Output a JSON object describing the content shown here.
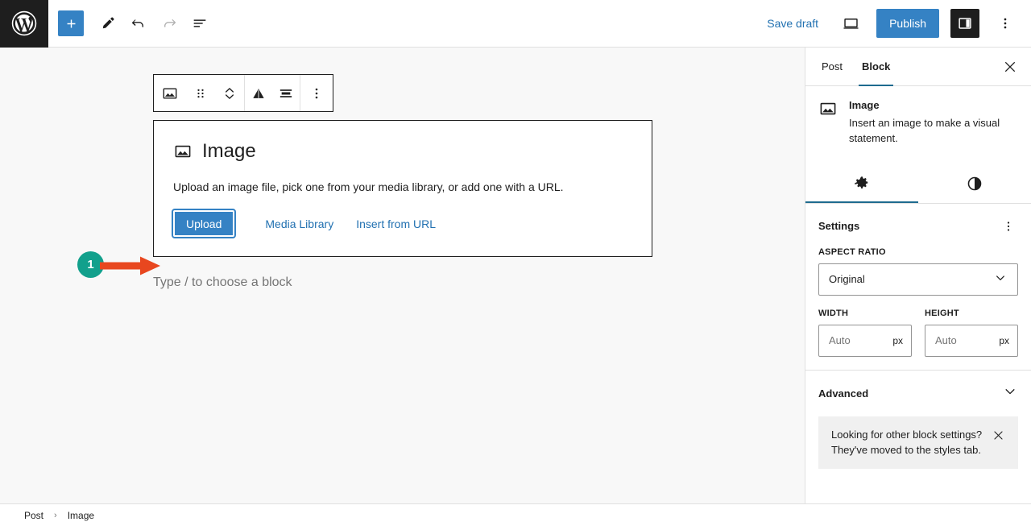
{
  "topbar": {
    "logo_icon": "wordpress-logo-icon",
    "add_block_icon": "plus-icon",
    "tools_icon": "pencil-icon",
    "undo_icon": "undo-arrow-icon",
    "redo_icon": "redo-arrow-icon",
    "list_view_icon": "document-overview-icon",
    "save_draft_label": "Save draft",
    "preview_icon": "desktop-preview-icon",
    "publish_label": "Publish",
    "sidebar_toggle_icon": "settings-panel-icon",
    "options_icon": "three-dots-vertical-icon"
  },
  "block_toolbar": {
    "block_type_icon": "image-block-icon",
    "drag_handle_icon": "drag-handle-dots-icon",
    "move_updown_icon": "move-up-down-chevrons-icon",
    "align_icon": "change-alignment-triangle-icon",
    "width_icon": "full-width-align-icon",
    "options_icon": "three-dots-vertical-icon"
  },
  "image_block": {
    "icon": "image-block-icon",
    "title": "Image",
    "description": "Upload an image file, pick one from your media library, or add one with a URL.",
    "upload_label": "Upload",
    "media_library_label": "Media Library",
    "insert_url_label": "Insert from URL"
  },
  "canvas": {
    "type_prompt": "Type / to choose a block"
  },
  "annotation": {
    "step_number": "1",
    "circle_color": "#12a08c",
    "arrow_color": "#e8471f",
    "arrow_icon": "right-arrow-annotation-icon"
  },
  "sidebar": {
    "tabs": [
      {
        "label": "Post",
        "active": false
      },
      {
        "label": "Block",
        "active": true
      }
    ],
    "close_icon": "close-x-icon",
    "block_card": {
      "icon": "image-block-icon",
      "title": "Image",
      "description": "Insert an image to make a visual statement."
    },
    "subtabs": [
      {
        "icon": "gear-settings-icon",
        "active": true
      },
      {
        "icon": "styles-contrast-icon",
        "active": false
      }
    ],
    "settings": {
      "title": "Settings",
      "options_icon": "three-dots-vertical-icon",
      "aspect_ratio_label": "ASPECT RATIO",
      "aspect_ratio_value": "Original",
      "aspect_ratio_chevron_icon": "chevron-down-icon",
      "width_label": "WIDTH",
      "width_placeholder": "Auto",
      "width_unit": "px",
      "height_label": "HEIGHT",
      "height_placeholder": "Auto",
      "height_unit": "px"
    },
    "advanced": {
      "title": "Advanced",
      "chevron_icon": "chevron-down-icon"
    },
    "notice": {
      "text": "Looking for other block settings? They've moved to the styles tab.",
      "close_icon": "close-x-icon"
    }
  },
  "footer": {
    "breadcrumb": [
      {
        "label": "Post"
      },
      {
        "label": "Image"
      }
    ],
    "separator": "›"
  },
  "colors": {
    "accent_blue": "#3582c4",
    "link_blue": "#2271b1",
    "dark": "#1e1e1e",
    "canvas_bg": "#f8f8f8",
    "tab_underline": "#1e6b8f"
  }
}
